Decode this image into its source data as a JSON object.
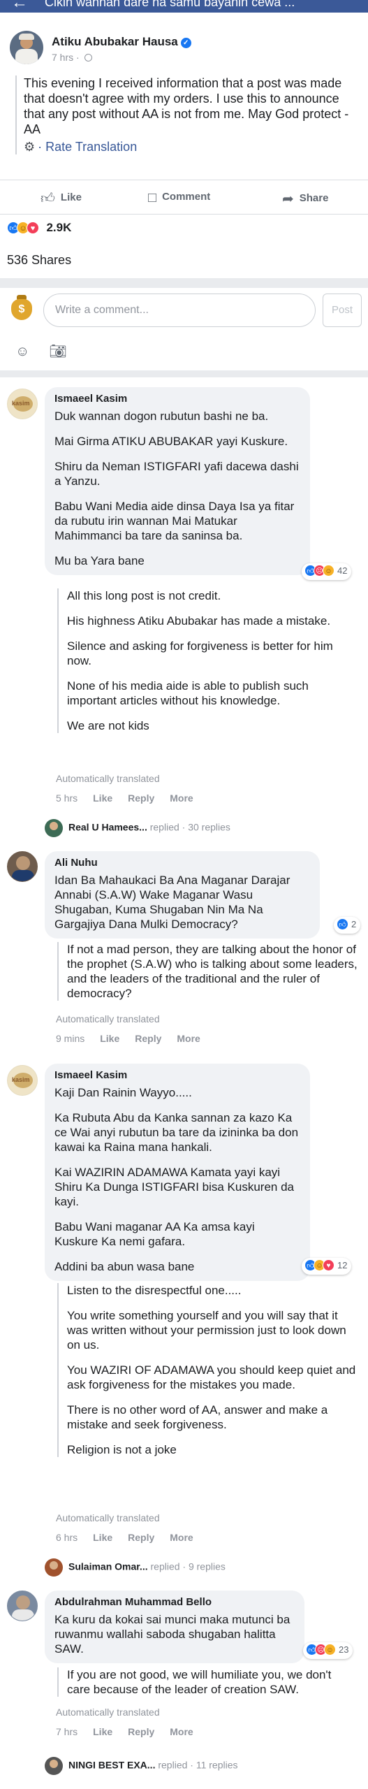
{
  "header": {
    "title": "Cikin wannan dare na samu bayanin cewa ...",
    "back_icon": "arrow-left-icon",
    "background": "#3b5998"
  },
  "post": {
    "author": "Atiku Abubakar Hausa",
    "time": "7 hrs ·",
    "text": "This evening I received information that a post was made that doesn't agree with my orders. I use this to announce that any post without AA is not from me. May God protect - AA",
    "rate_translation": "· Rate Translation",
    "actions": {
      "like": "Like",
      "comment": "Comment",
      "share": "Share"
    },
    "reaction_count": "2.9K",
    "shares": "536 Shares"
  },
  "composer": {
    "placeholder": "Write a comment...",
    "post_label": "Post"
  },
  "comments": [
    {
      "name": "Ismaeel Kasim",
      "avatar_text": "kasim",
      "paragraphs": [
        "Duk wannan dogon rubutun bashi ne ba.",
        "Mai Girma ATIKU ABUBAKAR yayi Kuskure.",
        "Shiru da Neman ISTIGFARI yafi dacewa dashi a Yanzu.",
        "Babu Wani Media aide dinsa Daya Isa ya fitar da rubutu irin wannan Mai Matukar Mahimmanci ba tare da saninsa ba.",
        "Mu ba Yara bane"
      ],
      "reaction_count": "42",
      "translation": [
        "All this long post is not credit.",
        "His highness Atiku Abubakar has made a mistake.",
        "Silence and asking for forgiveness is better for him now.",
        "None of his media aide is able to publish such important articles without his knowledge.",
        "We are not kids"
      ],
      "auto_translated": "Automatically translated",
      "time": "5 hrs",
      "like": "Like",
      "reply": "Reply",
      "more": "More",
      "replies": {
        "name": "Real U Hamees...",
        "text": " replied · 30 replies"
      }
    },
    {
      "name": "Ali Nuhu",
      "paragraphs": [
        "Idan Ba Mahaukaci Ba Ana Maganar Darajar Annabi (S.A.W) Wake Maganar Wasu Shugaban, Kuma Shugaban Nin Ma Na Gargajiya Dana Mulki Democracy?"
      ],
      "reaction_count": "2",
      "translation": [
        "If not a mad person, they are talking about the honor of the prophet (S.A.W) who is talking about some leaders, and the leaders of the traditional and the ruler of democracy?"
      ],
      "auto_translated": "Automatically translated",
      "time": "9 mins",
      "like": "Like",
      "reply": "Reply",
      "more": "More"
    },
    {
      "name": "Ismaeel Kasim",
      "avatar_text": "kasim",
      "paragraphs": [
        "Kaji Dan Rainin Wayyo.....",
        "Ka Rubuta Abu da Kanka sannan za kazo Ka ce Wai anyi rubutun ba tare da izininka ba don kawai ka Raina mana hankali.",
        "Kai WAZIRIN ADAMAWA Kamata yayi kayi Shiru Ka Dunga ISTIGFARI bisa Kuskuren da kayi.",
        "Babu Wani maganar AA Ka amsa kayi Kuskure Ka nemi gafara.",
        "Addini ba abun wasa bane"
      ],
      "reaction_count": "12",
      "translation": [
        "Listen to the disrespectful one.....",
        "You write something yourself and you will say that it was written without your permission just to look down on us.",
        "You WAZIRI OF ADAMAWA you should keep quiet and ask forgiveness for the mistakes you made.",
        "There is no other word of AA, answer and make a mistake and seek forgiveness.",
        "Religion is not a joke"
      ],
      "auto_translated": "Automatically translated",
      "time": "6 hrs",
      "like": "Like",
      "reply": "Reply",
      "more": "More",
      "replies": {
        "name": "Sulaiman Omar...",
        "text": " replied · 9 replies"
      }
    },
    {
      "name": "Abdulrahman Muhammad Bello",
      "paragraphs": [
        "Ka kuru da kokai sai munci maka mutunci ba ruwanmu wallahi saboda shugaban halitta SAW."
      ],
      "reaction_count": "23",
      "translation": [
        "If you are not good, we will humiliate you, we don't care because of the leader of creation SAW."
      ],
      "auto_translated": "Automatically translated",
      "time": "7 hrs",
      "like": "Like",
      "reply": "Reply",
      "more": "More",
      "replies": {
        "name": "NINGI BEST EXA...",
        "text": " replied · 11 replies"
      }
    }
  ]
}
